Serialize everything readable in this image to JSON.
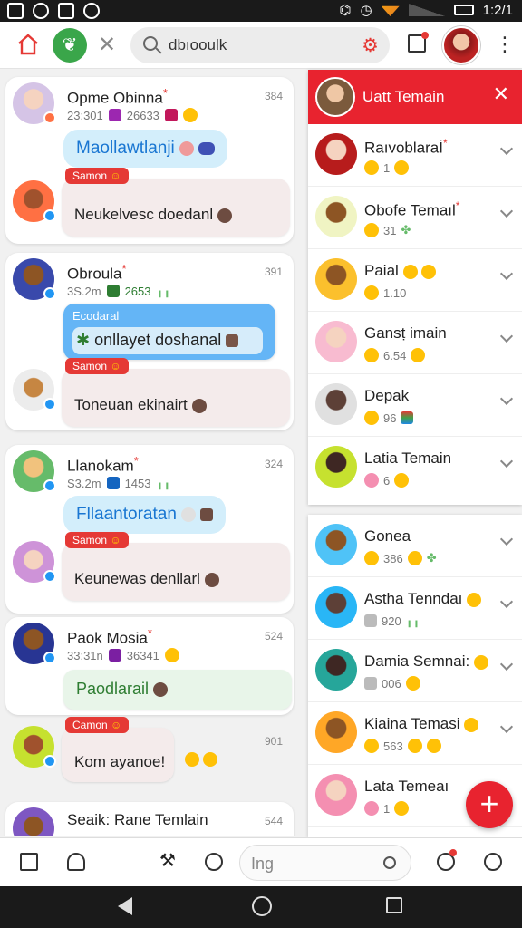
{
  "status_bar": {
    "time": "1:2/1"
  },
  "topbar": {
    "search_value": "dbıooulk"
  },
  "chat": [
    {
      "name": "Opme Obinna",
      "time": "384",
      "meta": "23:301",
      "meta_num": "26633",
      "bubble": "Maollawtlanji",
      "reply_tag": "Samon",
      "reply_text": "Neukelvesc doedanl"
    },
    {
      "name": "Obroula",
      "time": "391",
      "meta": "3S.2m",
      "meta_num": "2653",
      "bubble_label": "Ecodaral",
      "bubble": "onllayet doshanal",
      "reply_tag": "Samon",
      "reply_text": "Toneuan ekinairt"
    },
    {
      "name": "Llanokam",
      "time": "324",
      "meta": "S3.2m",
      "meta_num": "1453",
      "bubble": "Fllaantoratan",
      "reply_tag": "Samon",
      "reply_text": "Keunewas denllarl"
    },
    {
      "name": "Paok Mosia",
      "time": "524",
      "meta": "33:31n",
      "meta_num": "36341",
      "bubble": "Paodlarail",
      "reply_tag": "Camon",
      "reply_text": "Kom ayanoe!",
      "reply_time": "901"
    },
    {
      "name": "Seaik: Rane Temlain",
      "time": "544"
    }
  ],
  "panel": {
    "title": "Uatt Temain",
    "items": [
      {
        "name": "Raıvoblaraİ",
        "meta": "1",
        "star": true
      },
      {
        "name": "Obofe Temaıl",
        "meta": "31",
        "star": true
      },
      {
        "name": "Paial",
        "meta": "1.10"
      },
      {
        "name": "Gansṭ imain",
        "meta": "6.54"
      },
      {
        "name": "Depak",
        "meta": "96"
      },
      {
        "name": "Latia Temain",
        "meta": "6"
      }
    ]
  },
  "panel2": {
    "items": [
      {
        "name": "Gonea",
        "meta": "386"
      },
      {
        "name": "Astha Tenndaı",
        "meta": "920"
      },
      {
        "name": "Damia Semnai:",
        "meta": "006"
      },
      {
        "name": "Kiaina Temasi",
        "meta": "563"
      },
      {
        "name": "Lata Temeaı",
        "meta": "1"
      }
    ]
  },
  "bottombar": {
    "search_value": "Ing"
  },
  "colors": {
    "accent": "#e8232f",
    "green": "#3aa64a",
    "bubble_blue": "#d3eefb"
  }
}
